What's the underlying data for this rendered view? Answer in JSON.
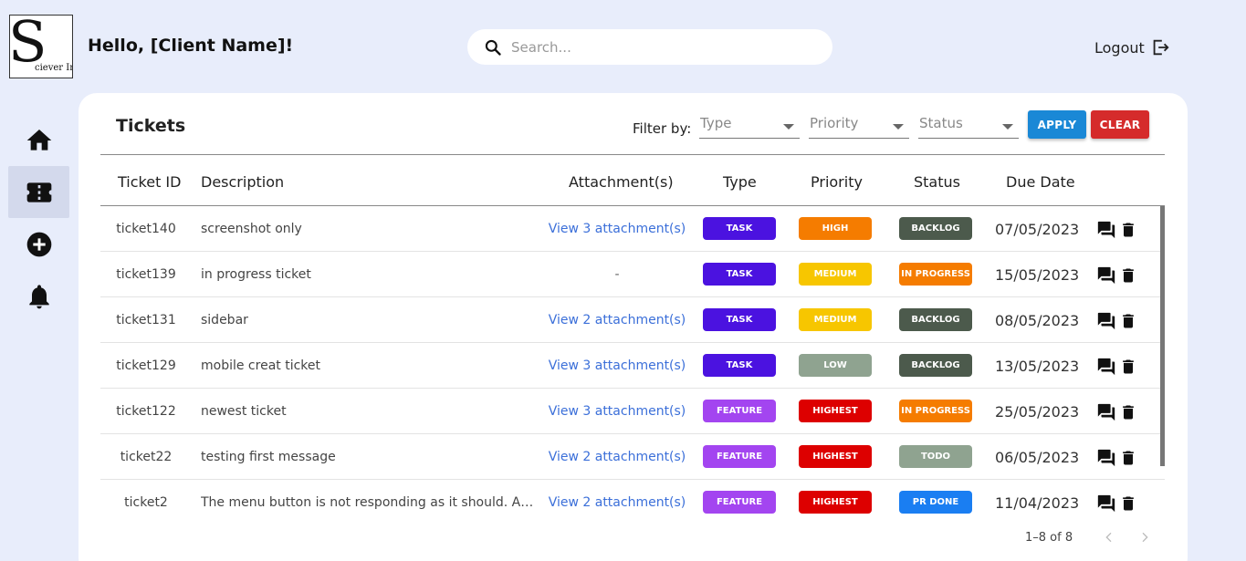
{
  "logo": {
    "big": "S",
    "small": "ciever Inc."
  },
  "header": {
    "greeting": "Hello, [Client Name]!",
    "search_placeholder": "Search...",
    "logout_label": "Logout"
  },
  "icons": {
    "search": "search-icon",
    "logout": "logout-icon",
    "home": "home-icon",
    "ticket": "ticket-icon",
    "add": "add-circle-icon",
    "bell": "bell-icon",
    "comment": "comment-icon",
    "trash": "trash-icon"
  },
  "main": {
    "title": "Tickets",
    "filter_label": "Filter by:",
    "filters": [
      "Type",
      "Priority",
      "Status"
    ],
    "apply_label": "APPLY",
    "clear_label": "CLEAR"
  },
  "table": {
    "headers": [
      "Ticket ID",
      "Description",
      "Attachment(s)",
      "Type",
      "Priority",
      "Status",
      "Due Date"
    ],
    "rows": [
      {
        "id": "ticket140",
        "desc": "screenshot only",
        "att": "View 3 attachment(s)",
        "type": "TASK",
        "priority": "HIGH",
        "status": "BACKLOG",
        "due": "07/05/2023"
      },
      {
        "id": "ticket139",
        "desc": "in progress ticket",
        "att": "-",
        "type": "TASK",
        "priority": "MEDIUM",
        "status": "IN PROGRESS",
        "due": "15/05/2023"
      },
      {
        "id": "ticket131",
        "desc": "sidebar",
        "att": "View 2 attachment(s)",
        "type": "TASK",
        "priority": "MEDIUM",
        "status": "BACKLOG",
        "due": "08/05/2023"
      },
      {
        "id": "ticket129",
        "desc": "mobile creat ticket",
        "att": "View 3 attachment(s)",
        "type": "TASK",
        "priority": "LOW",
        "status": "BACKLOG",
        "due": "13/05/2023"
      },
      {
        "id": "ticket122",
        "desc": "newest ticket",
        "att": "View 3 attachment(s)",
        "type": "FEATURE",
        "priority": "HIGHEST",
        "status": "IN PROGRESS",
        "due": "25/05/2023"
      },
      {
        "id": "ticket22",
        "desc": "testing first message",
        "att": "View 2 attachment(s)",
        "type": "FEATURE",
        "priority": "HIGHEST",
        "status": "TODO",
        "due": "06/05/2023"
      },
      {
        "id": "ticket2",
        "desc": "The menu button is not responding as it should. Also, s...",
        "att": "View 2 attachment(s)",
        "type": "FEATURE",
        "priority": "HIGHEST",
        "status": "PR DONE",
        "due": "11/04/2023"
      }
    ]
  },
  "pagination": {
    "label": "1–8 of 8"
  },
  "colors": {
    "TASK": "#4b12e0",
    "FEATURE": "#a345f0",
    "HIGH": "#f57c00",
    "MEDIUM": "#f7c600",
    "LOW": "#8fa390",
    "HIGHEST": "#dd0000",
    "BACKLOG": "#4c5a4c",
    "IN PROGRESS": "#f57c00",
    "TODO": "#8fa390",
    "PR DONE": "#1a7ef2",
    "background": "#e8edfb",
    "link": "#3b6fd9"
  }
}
